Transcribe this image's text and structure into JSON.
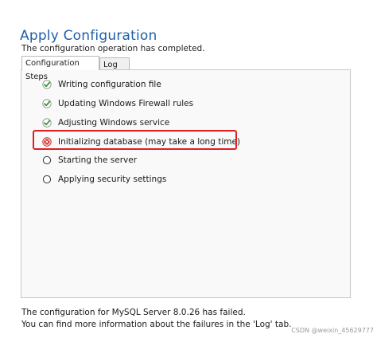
{
  "header": {
    "title": "Apply Configuration",
    "subtitle": "The configuration operation has completed."
  },
  "tabs": [
    {
      "label": "Configuration Steps",
      "active": true
    },
    {
      "label": "Log",
      "active": false
    }
  ],
  "steps": [
    {
      "label": "Writing configuration file",
      "status": "completed",
      "icon": "check-circle-icon"
    },
    {
      "label": "Updating Windows Firewall rules",
      "status": "completed",
      "icon": "check-circle-icon"
    },
    {
      "label": "Adjusting Windows service",
      "status": "completed",
      "icon": "check-circle-icon"
    },
    {
      "label": "Initializing database (may take a long time)",
      "status": "failed",
      "icon": "error-circle-icon"
    },
    {
      "label": "Starting the server",
      "status": "pending",
      "icon": "empty-circle-icon"
    },
    {
      "label": "Applying security settings",
      "status": "pending",
      "icon": "empty-circle-icon"
    }
  ],
  "footer": {
    "line1": "The configuration for MySQL Server 8.0.26 has failed.",
    "line2": "You can find more information about the failures in the 'Log' tab."
  },
  "watermark": "CSDN @weixin_45629777",
  "colors": {
    "title": "#1f5fa8",
    "success": "#2e9b2e",
    "error": "#d11f1f",
    "highlight": "#e02020"
  }
}
